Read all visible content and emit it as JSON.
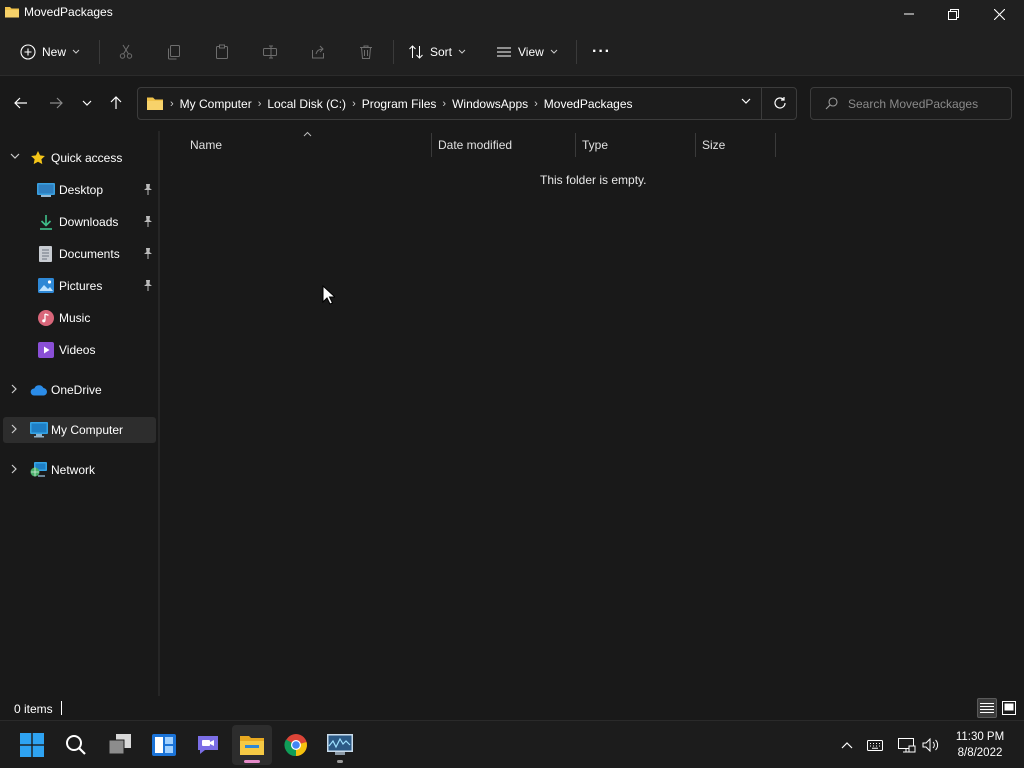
{
  "window": {
    "title": "MovedPackages",
    "minimize_glyph": "─",
    "maximize_glyph": "❐",
    "close_glyph": "✕"
  },
  "command_bar": {
    "new_label": "New",
    "sort_label": "Sort",
    "view_label": "View",
    "more_glyph": "···"
  },
  "address_bar": {
    "crumbs": [
      "My Computer",
      "Local Disk (C:)",
      "Program Files",
      "WindowsApps",
      "MovedPackages"
    ],
    "separator": "›"
  },
  "search": {
    "placeholder": "Search MovedPackages"
  },
  "sidebar": {
    "quick_access": "Quick access",
    "items": [
      {
        "label": "Desktop",
        "icon": "desktop-icon",
        "pinned": true
      },
      {
        "label": "Downloads",
        "icon": "downloads-icon",
        "pinned": true
      },
      {
        "label": "Documents",
        "icon": "documents-icon",
        "pinned": true
      },
      {
        "label": "Pictures",
        "icon": "pictures-icon",
        "pinned": true
      },
      {
        "label": "Music",
        "icon": "music-icon",
        "pinned": false
      },
      {
        "label": "Videos",
        "icon": "videos-icon",
        "pinned": false
      }
    ],
    "onedrive": "OneDrive",
    "my_computer": "My Computer",
    "network": "Network"
  },
  "content": {
    "columns": [
      "Name",
      "Date modified",
      "Type",
      "Size"
    ],
    "empty_message": "This folder is empty."
  },
  "status": {
    "item_count": "0 items"
  },
  "taskbar": {
    "time": "11:30 PM",
    "date": "8/8/2022",
    "apps": [
      "start-icon",
      "search-icon",
      "task-view-icon",
      "widgets-icon",
      "chat-icon",
      "file-explorer-icon",
      "chrome-icon",
      "resource-monitor-icon"
    ]
  },
  "colors": {
    "background": "#191919",
    "accent_pink": "#e48ac8",
    "folder_yellow": "#f0c24a",
    "star_yellow": "#f5c518"
  }
}
